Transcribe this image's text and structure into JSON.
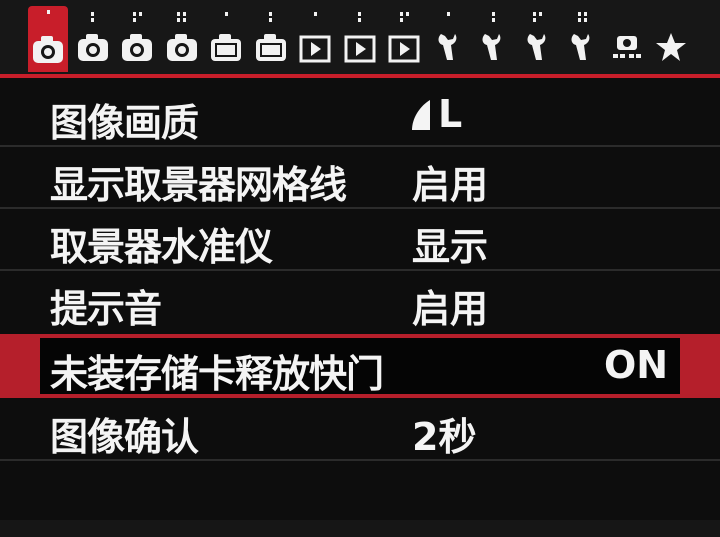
{
  "tabs": [
    {
      "name": "shooting-1",
      "dots": 1,
      "icon": "camera-icon",
      "active": true
    },
    {
      "name": "shooting-2",
      "dots": 2,
      "icon": "camera-icon"
    },
    {
      "name": "shooting-3",
      "dots": 3,
      "icon": "camera-icon"
    },
    {
      "name": "shooting-4",
      "dots": 4,
      "icon": "camera-icon"
    },
    {
      "name": "shooting-5",
      "dots": 1,
      "icon": "camera-box-icon"
    },
    {
      "name": "shooting-6",
      "dots": 2,
      "icon": "camera-box-icon"
    },
    {
      "name": "playback-1",
      "dots": 1,
      "icon": "play-icon"
    },
    {
      "name": "playback-2",
      "dots": 2,
      "icon": "play-icon"
    },
    {
      "name": "playback-3",
      "dots": 3,
      "icon": "play-icon"
    },
    {
      "name": "setup-1",
      "dots": 1,
      "icon": "wrench-icon"
    },
    {
      "name": "setup-2",
      "dots": 2,
      "icon": "wrench-icon"
    },
    {
      "name": "setup-3",
      "dots": 3,
      "icon": "wrench-icon"
    },
    {
      "name": "setup-4",
      "dots": 4,
      "icon": "wrench-icon"
    },
    {
      "name": "custom-functions",
      "dots": 0,
      "icon": "custom-function-icon"
    },
    {
      "name": "my-menu",
      "dots": 0,
      "icon": "star-icon"
    }
  ],
  "menu": {
    "items": [
      {
        "label": "图像画质",
        "value": "L",
        "value_icon": "fine-quality-icon"
      },
      {
        "label": "显示取景器网格线",
        "value": "启用"
      },
      {
        "label": "取景器水准仪",
        "value": "显示"
      },
      {
        "label": "提示音",
        "value": "启用"
      },
      {
        "label": "未装存储卡释放快门",
        "value": "ON",
        "selected": true
      },
      {
        "label": "图像确认",
        "value": "2秒"
      }
    ]
  },
  "colors": {
    "accent": "#c81e2a",
    "background": "#0d0d0d",
    "text": "#f4f4f4"
  }
}
